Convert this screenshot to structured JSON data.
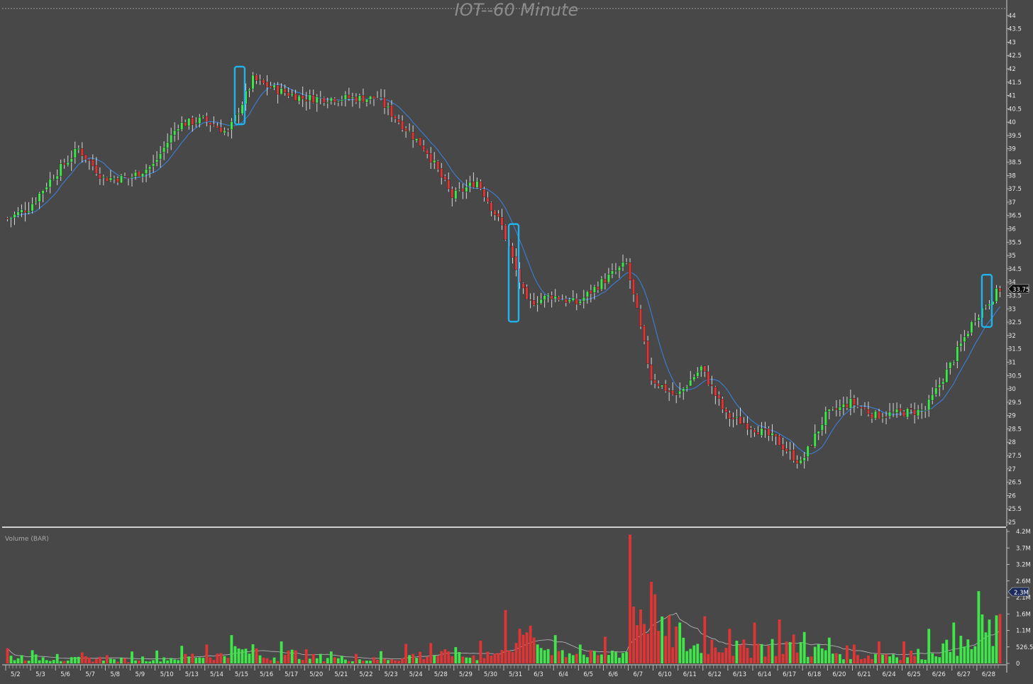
{
  "chart_data": [
    {
      "type": "candlestick",
      "title": "IOT--60 Minute",
      "timeframe": "60 Minute",
      "symbol": "IOT",
      "ylim": [
        25,
        44.5
      ],
      "ytick_labels": [
        "25",
        "25.5",
        "26",
        "26.5",
        "27",
        "27.5",
        "28",
        "28.5",
        "29",
        "29.5",
        "30",
        "30.5",
        "31",
        "31.5",
        "32",
        "32.5",
        "33",
        "33.5",
        "34",
        "34.5",
        "35",
        "35.5",
        "36",
        "36.5",
        "37",
        "37.5",
        "38",
        "38.5",
        "39",
        "39.5",
        "40",
        "40.5",
        "41",
        "41.5",
        "42",
        "42.5",
        "43",
        "43.5",
        "44"
      ],
      "last_price_label": "33.75",
      "last_price": 33.75,
      "dates": [
        "5/2",
        "5/3",
        "5/6",
        "5/7",
        "5/8",
        "5/9",
        "5/10",
        "5/13",
        "5/14",
        "5/15",
        "5/16",
        "5/17",
        "5/20",
        "5/21",
        "5/22",
        "5/23",
        "5/24",
        "5/28",
        "5/29",
        "5/30",
        "5/31",
        "6/3",
        "6/4",
        "6/5",
        "6/6",
        "6/7",
        "6/10",
        "6/11",
        "6/12",
        "6/13",
        "6/14",
        "6/17",
        "6/18",
        "6/20",
        "6/21",
        "6/24",
        "6/25",
        "6/26",
        "6/27",
        "6/28"
      ],
      "session_closes": [
        36.8,
        38.0,
        39.0,
        37.9,
        37.9,
        38.4,
        39.9,
        40.1,
        39.6,
        41.6,
        41.2,
        40.9,
        40.9,
        40.9,
        40.9,
        39.9,
        38.9,
        37.2,
        37.8,
        36.1,
        33.2,
        33.5,
        33.2,
        34.0,
        34.7,
        30.4,
        29.7,
        30.8,
        29.0,
        28.6,
        28.1,
        27.2,
        29.0,
        29.5,
        29.0,
        29.1,
        29.2,
        30.9,
        32.7,
        33.75
      ],
      "highlight_boxes": [
        {
          "date": "5/15",
          "low": 40.0,
          "high": 42.0
        },
        {
          "date": "5/31",
          "low": 32.6,
          "high": 36.1
        },
        {
          "date": "6/28",
          "low": 32.4,
          "high": 34.2
        }
      ],
      "colors": {
        "up": "#3ee64a",
        "down": "#e03535",
        "ma": "#3a7fd6",
        "highlight": "#1fb4ee",
        "background": "#484848"
      }
    },
    {
      "type": "bar",
      "title": "Volume (BAR)",
      "ytick_labels": [
        "0",
        "526.5K",
        "1.1M",
        "1.6M",
        "2.1M",
        "2.6M",
        "3.2M",
        "3.7M",
        "4.2M"
      ],
      "last_value_label": "2.3M",
      "ylim": [
        0,
        4200000
      ],
      "session_volume_peaks": [
        480000,
        420000,
        300000,
        350000,
        260000,
        380000,
        410000,
        560000,
        600000,
        900000,
        480000,
        700000,
        450000,
        380000,
        300000,
        390000,
        620000,
        650000,
        520000,
        720000,
        1700000,
        1200000,
        900000,
        600000,
        850000,
        4100000,
        2200000,
        1300000,
        1500000,
        1100000,
        1300000,
        1400000,
        1000000,
        820000,
        600000,
        700000,
        700000,
        1100000,
        1300000,
        2300000
      ]
    }
  ]
}
